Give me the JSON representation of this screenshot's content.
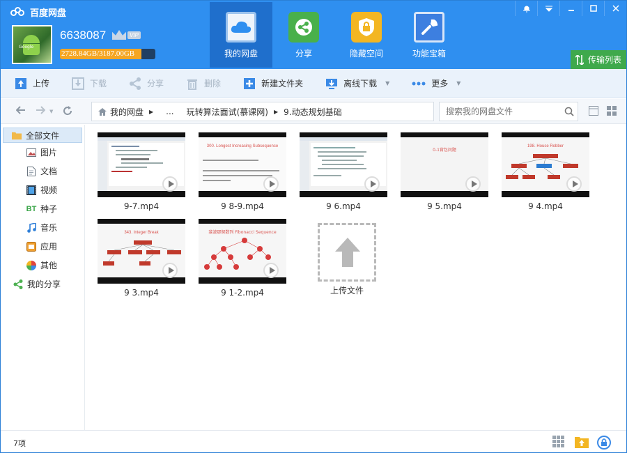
{
  "app": {
    "title": "百度网盘"
  },
  "user": {
    "name": "6638087",
    "vip_label": "VIP",
    "quota_text": "2728.84GB/3187.00GB",
    "quota_used_fraction": 0.856,
    "avatar_caption": "Google"
  },
  "nav": [
    {
      "label": "我的网盘",
      "icon": "cloud-icon",
      "active": true
    },
    {
      "label": "分享",
      "icon": "share-icon"
    },
    {
      "label": "隐藏空间",
      "icon": "lock-icon"
    },
    {
      "label": "功能宝箱",
      "icon": "toolbox-icon"
    }
  ],
  "window_controls": [
    "bell-icon",
    "menu-icon",
    "minimize-icon",
    "maximize-icon",
    "close-icon"
  ],
  "transfer_label": "传输列表",
  "toolbar": {
    "upload": "上传",
    "download": "下载",
    "share": "分享",
    "delete": "删除",
    "new_folder": "新建文件夹",
    "offline": "离线下载",
    "more": "更多"
  },
  "breadcrumb": {
    "root": "我的网盘",
    "ellipsis": "...",
    "parent": "玩转算法面试(慕课网)",
    "current": "9.动态规划基础"
  },
  "search": {
    "placeholder": "搜索我的网盘文件"
  },
  "sidebar": [
    {
      "label": "全部文件",
      "icon": "folder-icon",
      "active": true
    },
    {
      "label": "图片",
      "icon": "image-icon"
    },
    {
      "label": "文档",
      "icon": "document-icon"
    },
    {
      "label": "视频",
      "icon": "video-icon"
    },
    {
      "label": "种子",
      "icon": "bt-icon",
      "icon_text": "BT"
    },
    {
      "label": "音乐",
      "icon": "music-icon"
    },
    {
      "label": "应用",
      "icon": "app-icon"
    },
    {
      "label": "其他",
      "icon": "other-icon"
    },
    {
      "label": "我的分享",
      "icon": "share-icon"
    }
  ],
  "files": [
    {
      "name": "9-7.mp4",
      "slide_title": "",
      "kind": "code"
    },
    {
      "name": "9 8-9.mp4",
      "slide_title": "300. Longest Increasing Subsequence",
      "kind": "text"
    },
    {
      "name": "9 6.mp4",
      "slide_title": "",
      "kind": "code"
    },
    {
      "name": "9 5.mp4",
      "slide_title": "0-1背包问题",
      "kind": "blank"
    },
    {
      "name": "9 4.mp4",
      "slide_title": "198. House Robber",
      "kind": "tree"
    },
    {
      "name": "9 3.mp4",
      "slide_title": "343. Integer Break",
      "kind": "tree"
    },
    {
      "name": "9 1-2.mp4",
      "slide_title": "斐波那契数列 Fibonacci Sequence",
      "kind": "dots"
    }
  ],
  "upload_tile": {
    "label": "上传文件"
  },
  "status": {
    "count": "7项"
  }
}
